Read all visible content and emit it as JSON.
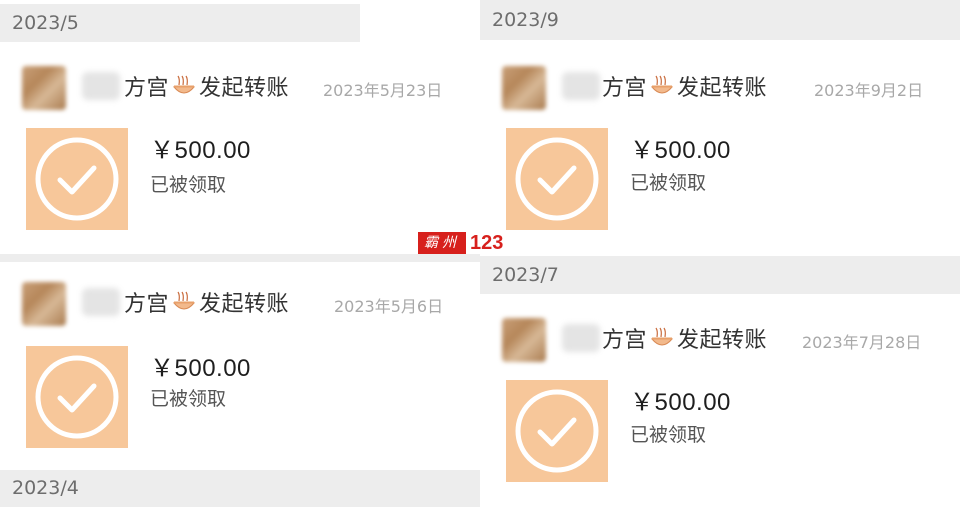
{
  "headers": {
    "top_left": "2023/5",
    "top_right": "2023/9",
    "mid_right": "2023/7",
    "bottom_left": "2023/4"
  },
  "transfers": [
    {
      "sender_suffix_1": "方宫",
      "sender_suffix_2": "发起转账",
      "date": "2023年5月23日",
      "amount": "￥500.00",
      "status": "已被领取"
    },
    {
      "sender_suffix_1": "方宫",
      "sender_suffix_2": "发起转账",
      "date": "2023年9月2日",
      "amount": "￥500.00",
      "status": "已被领取"
    },
    {
      "sender_suffix_1": "方宫",
      "sender_suffix_2": "发起转账",
      "date": "2023年5月6日",
      "amount": "￥500.00",
      "status": "已被领取"
    },
    {
      "sender_suffix_1": "方宫",
      "sender_suffix_2": "发起转账",
      "date": "2023年7月28日",
      "amount": "￥500.00",
      "status": "已被领取"
    }
  ],
  "watermark": {
    "logo_text": "霸州",
    "number": "123"
  },
  "colors": {
    "tile": "#f7c79a",
    "header_bg": "#ededed",
    "watermark_red": "#d7201c"
  },
  "icons": {
    "tile_icon": "check-circle-icon",
    "emoji": "noodle-bowl-icon"
  }
}
